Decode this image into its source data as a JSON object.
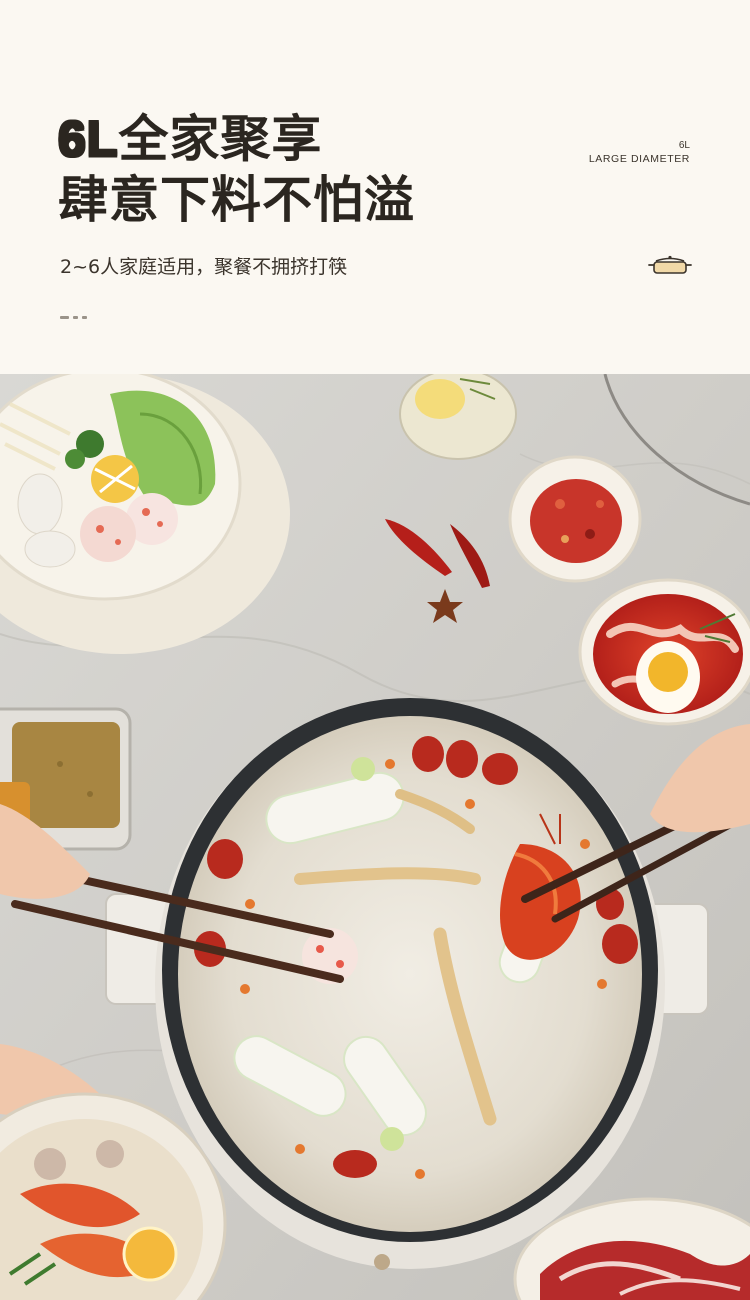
{
  "headline": {
    "line1_accent": "6L",
    "line1_rest": "全家聚享",
    "line2": "肆意下料不怕溢"
  },
  "subline": "2~6人家庭适用，聚餐不拥挤打筷",
  "corner": {
    "size": "6L",
    "caption": "LARGE DIAMETER"
  },
  "icons": {
    "corner_icon": "hot-pot-icon"
  },
  "colors": {
    "background": "#fbf8f2",
    "headline": "#2b2620",
    "accent_gold": "#c9a77a"
  }
}
